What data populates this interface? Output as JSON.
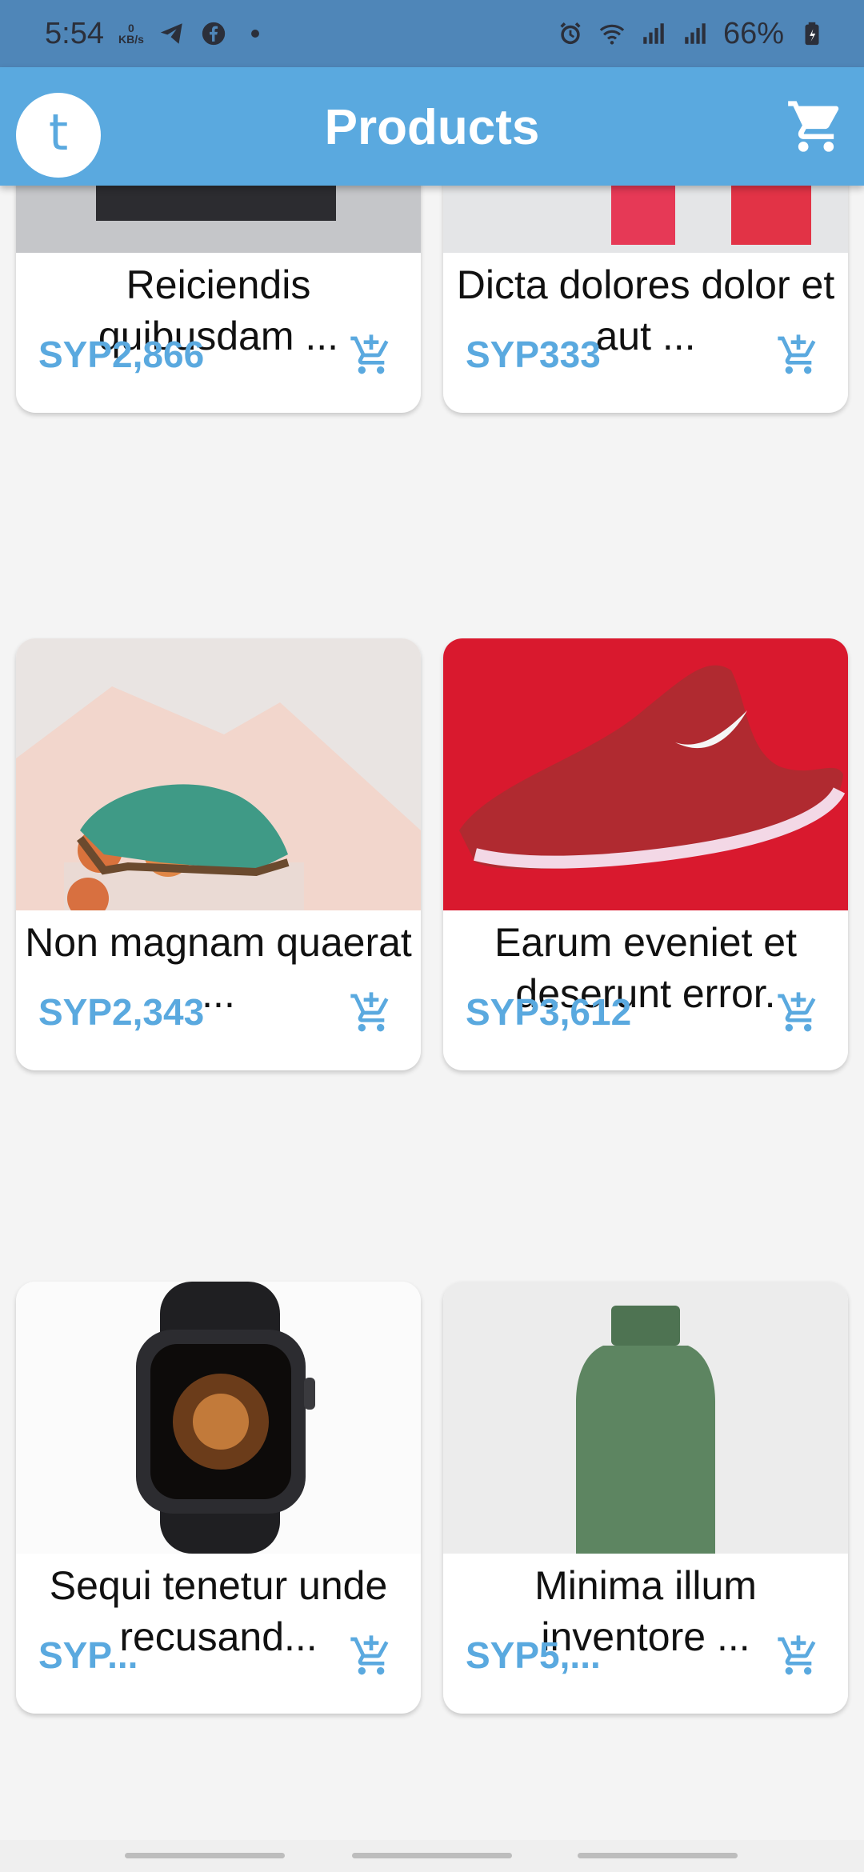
{
  "status_bar": {
    "time": "5:54",
    "net_speed_value": "0",
    "net_speed_unit": "KB/s",
    "battery": "66%"
  },
  "app_bar": {
    "avatar_letter": "t",
    "title": "Products"
  },
  "products": [
    {
      "name": "Reiciendis quibusdam ...",
      "price": "SYP2,866",
      "image": "instant-camera"
    },
    {
      "name": "Dicta dolores dolor et aut ...",
      "price": "SYP333",
      "image": "nail-polish"
    },
    {
      "name": "Non magnam quaerat ...",
      "price": "SYP2,343",
      "image": "green-shoe"
    },
    {
      "name": "Earum eveniet et deserunt error.",
      "price": "SYP3,612",
      "image": "red-sneaker"
    },
    {
      "name": "Sequi tenetur unde recusand...",
      "price": "SYP...",
      "image": "smart-watch"
    },
    {
      "name": "Minima illum inventore ...",
      "price": "SYP5,...",
      "image": "green-bottle"
    }
  ],
  "colors": {
    "primary": "#5aa9df",
    "status_bar": "#4f86b8",
    "background": "#f4f4f4"
  }
}
